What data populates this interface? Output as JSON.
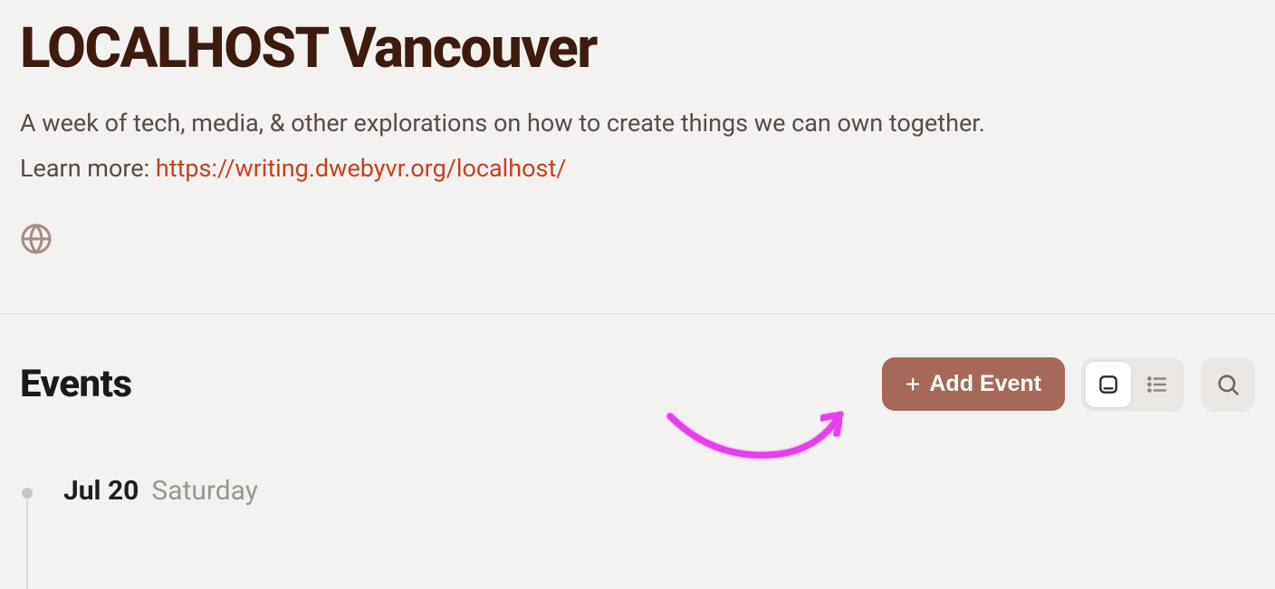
{
  "header": {
    "title": "LOCALHOST Vancouver",
    "description": "A week of tech, media, & other explorations on how to create things we can own together.",
    "learn_more_label": "Learn more: ",
    "learn_more_url": "https://writing.dwebyvr.org/localhost/"
  },
  "events": {
    "heading": "Events",
    "add_button_label": "Add Event",
    "timeline": [
      {
        "date": "Jul 20",
        "day": "Saturday"
      }
    ]
  }
}
